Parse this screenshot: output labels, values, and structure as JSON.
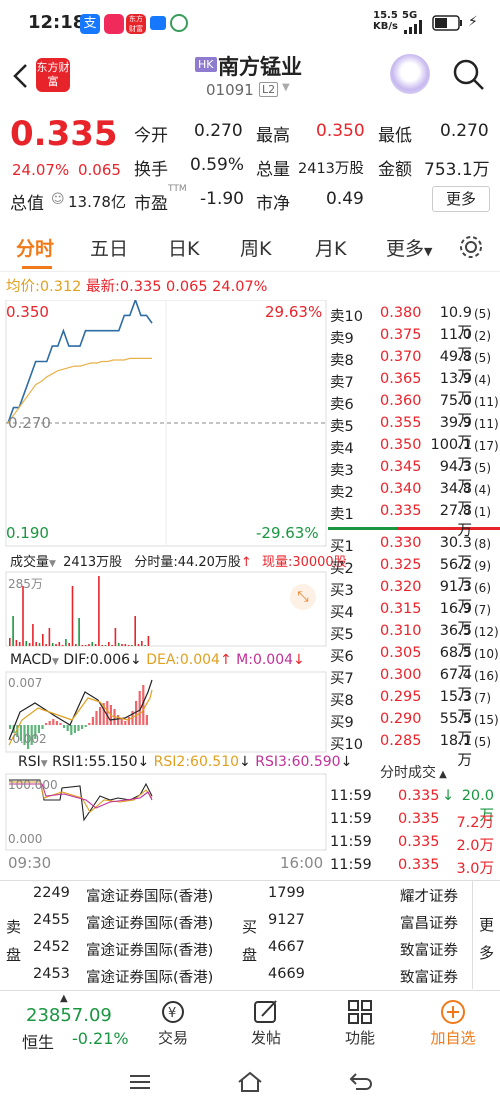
{
  "status_bar": {
    "time": "12:18",
    "net_speed": "15.5",
    "net_unit": "KB/s",
    "signal": "5G"
  },
  "header": {
    "app_logo": "东方财富",
    "market_badge": "HK",
    "stock_name": "南方锰业",
    "stock_code": "01091",
    "level_badge": "L2"
  },
  "quote": {
    "price": "0.335",
    "change_pct": "24.07%",
    "change_amt": "0.065",
    "open_label": "今开",
    "open": "0.270",
    "high_label": "最高",
    "high": "0.350",
    "low_label": "最低",
    "low": "0.270",
    "turnover_label": "换手",
    "turnover": "0.59%",
    "volume_label": "总量",
    "volume": "2413万股",
    "amount_label": "金额",
    "amount": "753.1万",
    "mktcap_label": "总值",
    "mktcap": "13.78亿",
    "pe_label": "市盈",
    "pe_sup": "TTM",
    "pe": "-1.90",
    "pb_label": "市净",
    "pb": "0.49",
    "more_button": "更多"
  },
  "tabs": [
    "分时",
    "五日",
    "日K",
    "周K",
    "月K",
    "更多"
  ],
  "avg_line": {
    "avg_label": "均价:",
    "avg": "0.312",
    "latest_label": "最新:",
    "latest": "0.335",
    "chg": "0.065",
    "pct": "24.07%"
  },
  "price_chart": {
    "y_top": "0.350",
    "y_top_pct": "29.63%",
    "y_mid": "0.270",
    "y_bottom": "0.190",
    "y_bottom_pct": "-29.63%"
  },
  "volume_panel": {
    "label": "成交量",
    "total": "2413万股",
    "per_min": "分时量:44.20万股",
    "current": "现量:30000股",
    "y_max": "285万"
  },
  "macd_panel": {
    "label": "MACD",
    "dif": "DIF:0.006",
    "dea": "DEA:0.004",
    "m": "M:0.004",
    "y_top": "0.007",
    "y_bottom": "-0.002"
  },
  "rsi_panel": {
    "label": "RSI",
    "rsi1": "RSI1:55.150",
    "rsi2": "RSI2:60.510",
    "rsi3": "RSI3:60.590",
    "y_top": "100.000",
    "y_bottom": "0.000"
  },
  "time_axis": {
    "start": "09:30",
    "end": "16:00"
  },
  "chart_data": {
    "type": "line",
    "title": "",
    "xlabel": "",
    "ylabel": "",
    "ylim": [
      0.19,
      0.35
    ],
    "series": [
      {
        "values": [
          0.27,
          0.28,
          0.28,
          0.29,
          0.3,
          0.31,
          0.31,
          0.31,
          0.32,
          0.32,
          0.33,
          0.32,
          0.32,
          0.32,
          0.33,
          0.33,
          0.33,
          0.33,
          0.33,
          0.33,
          0.33,
          0.34,
          0.34,
          0.35,
          0.34,
          0.34,
          0.335
        ]
      },
      {
        "values": [
          0.27,
          0.275,
          0.28,
          0.285,
          0.29,
          0.295,
          0.297,
          0.3,
          0.302,
          0.304,
          0.305,
          0.306,
          0.307,
          0.307,
          0.308,
          0.309,
          0.309,
          0.31,
          0.31,
          0.311,
          0.311,
          0.311,
          0.312,
          0.312,
          0.312,
          0.312,
          0.312
        ]
      }
    ]
  },
  "order_book": {
    "asks": [
      {
        "label": "卖10",
        "price": "0.380",
        "vol": "10.9万",
        "n": "(5)"
      },
      {
        "label": "卖9",
        "price": "0.375",
        "vol": "11.0万",
        "n": "(2)"
      },
      {
        "label": "卖8",
        "price": "0.370",
        "vol": "49.8万",
        "n": "(5)"
      },
      {
        "label": "卖7",
        "price": "0.365",
        "vol": "13.9万",
        "n": "(4)"
      },
      {
        "label": "卖6",
        "price": "0.360",
        "vol": "75.0万",
        "n": "(11)"
      },
      {
        "label": "卖5",
        "price": "0.355",
        "vol": "39.9万",
        "n": "(11)"
      },
      {
        "label": "卖4",
        "price": "0.350",
        "vol": "100.1万",
        "n": "(17)"
      },
      {
        "label": "卖3",
        "price": "0.345",
        "vol": "94.3万",
        "n": "(5)"
      },
      {
        "label": "卖2",
        "price": "0.340",
        "vol": "34.8万",
        "n": "(4)"
      },
      {
        "label": "卖1",
        "price": "0.335",
        "vol": "27.8万",
        "n": "(1)"
      }
    ],
    "bids": [
      {
        "label": "买1",
        "price": "0.330",
        "vol": "30.3万",
        "n": "(8)"
      },
      {
        "label": "买2",
        "price": "0.325",
        "vol": "56.2万",
        "n": "(9)"
      },
      {
        "label": "买3",
        "price": "0.320",
        "vol": "91.3万",
        "n": "(6)"
      },
      {
        "label": "买4",
        "price": "0.315",
        "vol": "16.9万",
        "n": "(7)"
      },
      {
        "label": "买5",
        "price": "0.310",
        "vol": "36.5万",
        "n": "(12)"
      },
      {
        "label": "买6",
        "price": "0.305",
        "vol": "68.5万",
        "n": "(10)"
      },
      {
        "label": "买7",
        "price": "0.300",
        "vol": "67.4万",
        "n": "(16)"
      },
      {
        "label": "买8",
        "price": "0.295",
        "vol": "15.3万",
        "n": "(7)"
      },
      {
        "label": "买9",
        "price": "0.290",
        "vol": "55.5万",
        "n": "(15)"
      },
      {
        "label": "买10",
        "price": "0.285",
        "vol": "18.1万",
        "n": "(5)"
      }
    ]
  },
  "ticks": {
    "title": "分时成交",
    "rows": [
      {
        "time": "11:59",
        "price": "0.335",
        "vol": "20.0万"
      },
      {
        "time": "11:59",
        "price": "0.335",
        "vol": "7.2万"
      },
      {
        "time": "11:59",
        "price": "0.335",
        "vol": "2.0万"
      },
      {
        "time": "11:59",
        "price": "0.335",
        "vol": "3.0万"
      }
    ]
  },
  "brokers": {
    "sell_label": "卖盘",
    "buy_label": "买盘",
    "more": "更多",
    "sell": [
      {
        "id": "2249",
        "name": "富途证券国际(香港)"
      },
      {
        "id": "2455",
        "name": "富途证券国际(香港)"
      },
      {
        "id": "2452",
        "name": "富途证券国际(香港)"
      },
      {
        "id": "2453",
        "name": "富途证券国际(香港)"
      }
    ],
    "buy": [
      {
        "id": "1799",
        "name": "耀才证券"
      },
      {
        "id": "9127",
        "name": "富昌证券"
      },
      {
        "id": "4667",
        "name": "致富证券"
      },
      {
        "id": "4669",
        "name": "致富证券"
      }
    ]
  },
  "bottom_bar": {
    "index_value": "23857.09",
    "index_name": "恒生",
    "index_pct": "-0.21%",
    "trade": "交易",
    "post": "发帖",
    "function": "功能",
    "add_watch": "加自选"
  },
  "colors": {
    "up": "#e8242b",
    "down": "#1a9641",
    "accent": "#f07a1a",
    "price_line": "#2e6ca4",
    "avg_line": "#e8b24a"
  }
}
